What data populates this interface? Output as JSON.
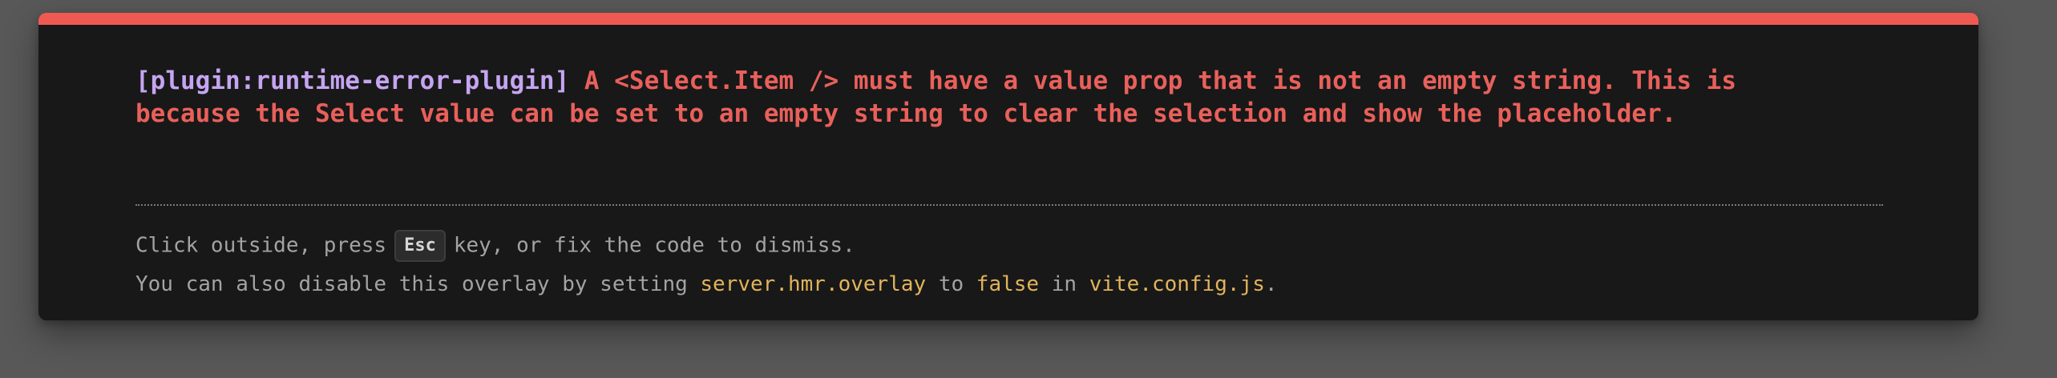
{
  "error": {
    "plugin": "[plugin:runtime-error-plugin]",
    "message": " A <Select.Item /> must have a value prop that is not an empty string. This is\nbecause the Select value can be set to an empty string to clear the selection and show the placeholder."
  },
  "tip": {
    "line1_before": "Click outside, press",
    "key": "Esc",
    "line1_after": "key, or fix the code to dismiss.",
    "line2_part1": "You can also disable this overlay by setting ",
    "config_option": "server.hmr.overlay",
    "line2_part2": " to ",
    "config_value": "false",
    "line2_part3": " in ",
    "config_file": "vite.config.js",
    "line2_end": "."
  },
  "colors": {
    "accent_bar": "#ee5a52",
    "error_text": "#e9605b",
    "plugin_text": "#c5a5f2",
    "code_text": "#e1b35b",
    "window_bg": "#181818",
    "backdrop": "#585858"
  }
}
